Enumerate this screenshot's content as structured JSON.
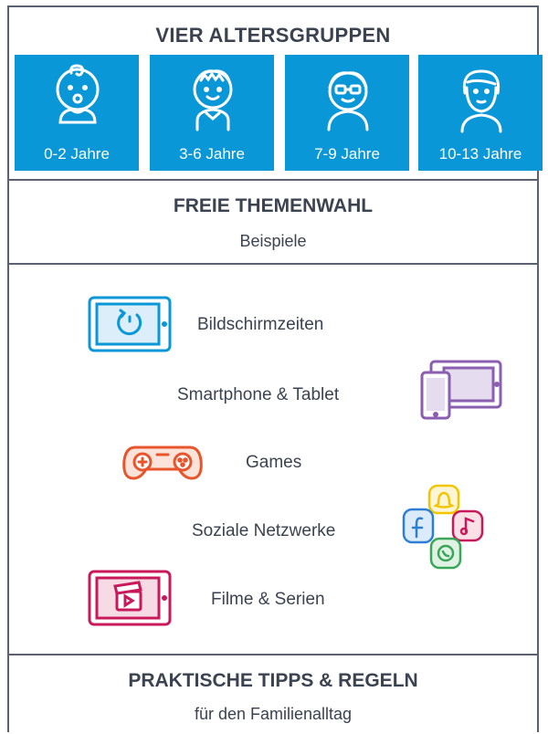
{
  "age_groups": {
    "title": "VIER ALTERSGRUPPEN",
    "items": [
      {
        "label": "0-2 Jahre",
        "icon": "baby-icon"
      },
      {
        "label": "3-6 Jahre",
        "icon": "child-icon"
      },
      {
        "label": "7-9 Jahre",
        "icon": "glasses-child-icon"
      },
      {
        "label": "10-13 Jahre",
        "icon": "teen-icon"
      }
    ],
    "color": "#0a97d8"
  },
  "topics": {
    "title": "FREIE THEMENWAHL",
    "subtitle": "Beispiele",
    "items": [
      {
        "label": "Bildschirmzeiten",
        "icon": "tablet-timer-icon",
        "color": "#0a97d8"
      },
      {
        "label": "Smartphone & Tablet",
        "icon": "phone-tablet-icon",
        "color": "#8b5fb0"
      },
      {
        "label": "Games",
        "icon": "gamepad-icon",
        "color": "#e8542b"
      },
      {
        "label": "Soziale Netzwerke",
        "icon": "social-apps-icon",
        "color": "#3aa65a"
      },
      {
        "label": "Filme & Serien",
        "icon": "tablet-film-icon",
        "color": "#c8195a"
      }
    ]
  },
  "tips": {
    "title": "PRAKTISCHE TIPPS & REGELN",
    "subtitle": "für den Familienalltag"
  }
}
